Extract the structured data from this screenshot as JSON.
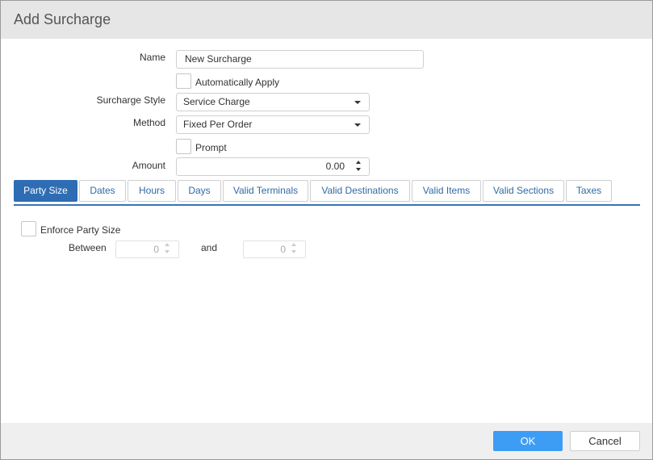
{
  "dialog": {
    "title": "Add Surcharge"
  },
  "form": {
    "name_label": "Name",
    "name_value": "New Surcharge",
    "auto_apply_label": "Automatically Apply",
    "surcharge_style_label": "Surcharge Style",
    "surcharge_style_value": "Service Charge",
    "method_label": "Method",
    "method_value": "Fixed Per Order",
    "prompt_label": "Prompt",
    "amount_label": "Amount",
    "amount_value": "0.00"
  },
  "tabs": [
    {
      "label": "Party Size",
      "active": true
    },
    {
      "label": "Dates"
    },
    {
      "label": "Hours"
    },
    {
      "label": "Days"
    },
    {
      "label": "Valid Terminals"
    },
    {
      "label": "Valid Destinations"
    },
    {
      "label": "Valid Items"
    },
    {
      "label": "Valid Sections"
    },
    {
      "label": "Taxes"
    }
  ],
  "party_size": {
    "enforce_label": "Enforce Party Size",
    "between_label": "Between",
    "between_value": "0",
    "and_label": "and",
    "and_value": "0"
  },
  "footer": {
    "ok_label": "OK",
    "cancel_label": "Cancel"
  },
  "colors": {
    "tab_active": "#2e6db4",
    "tab_text": "#2f6aa6",
    "ok_button": "#3d9df5"
  }
}
